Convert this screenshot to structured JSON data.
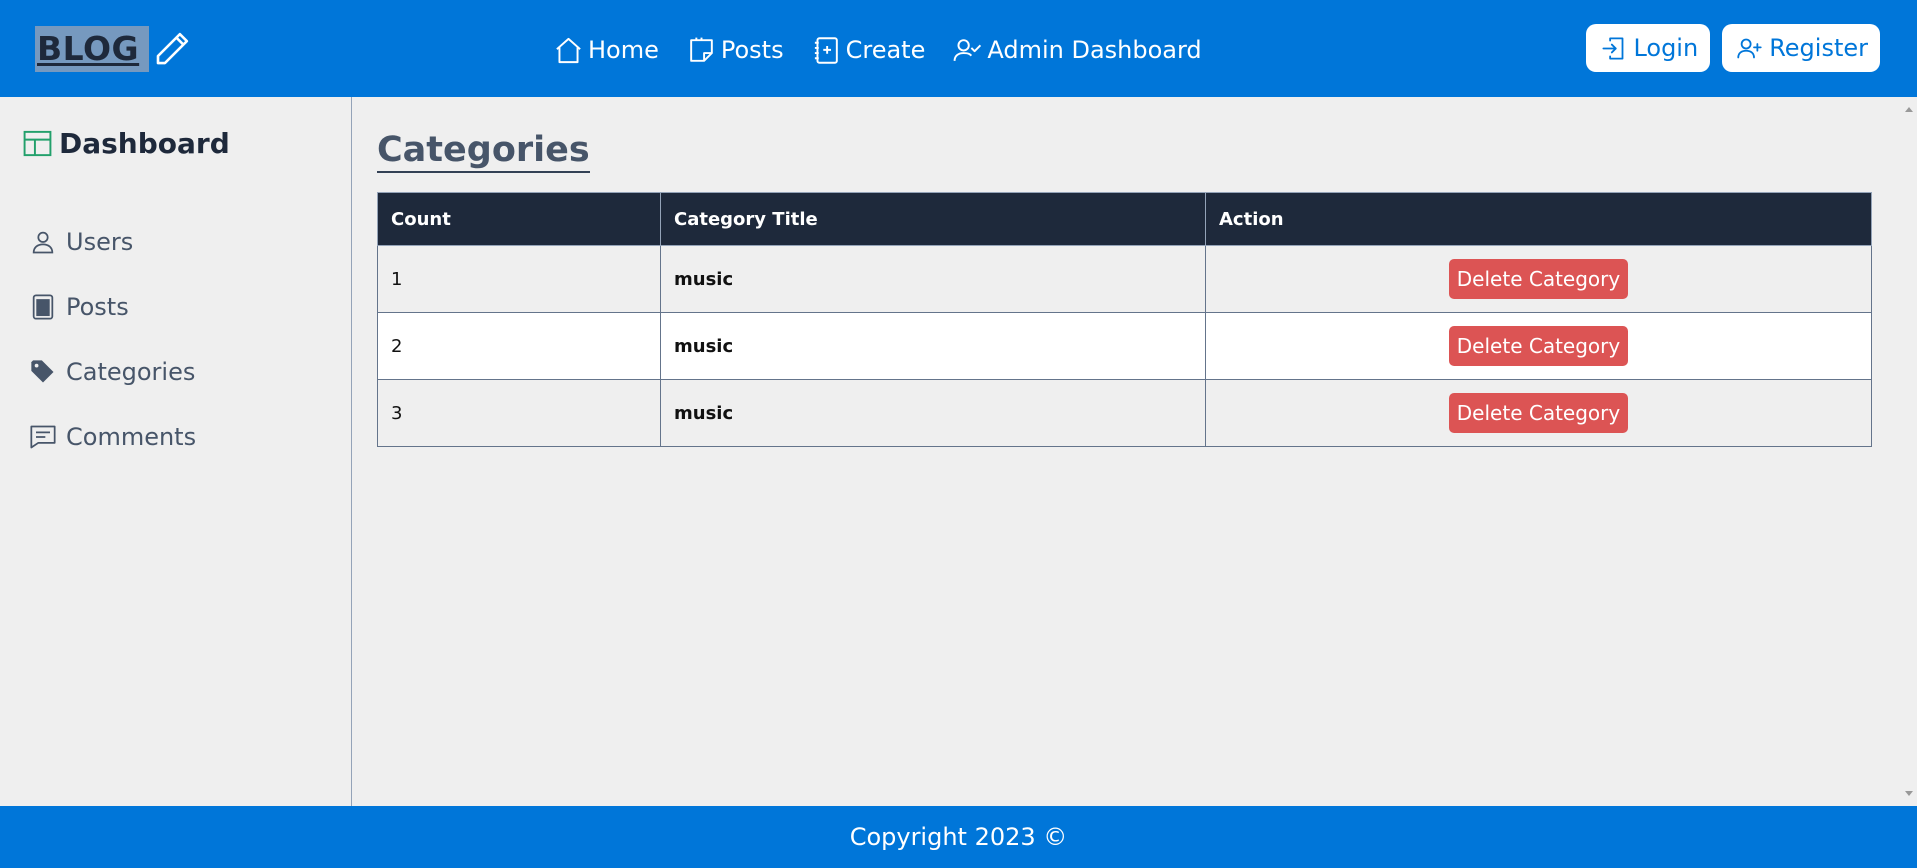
{
  "header": {
    "logo_text": "BLOG",
    "logo_icon": "pencil-icon",
    "nav": [
      {
        "label": "Home",
        "icon": "house-icon"
      },
      {
        "label": "Posts",
        "icon": "sticky-note-icon"
      },
      {
        "label": "Create",
        "icon": "journal-plus-icon"
      },
      {
        "label": "Admin Dashboard",
        "icon": "person-check-icon"
      }
    ],
    "login_label": "Login",
    "register_label": "Register"
  },
  "sidebar": {
    "title": "Dashboard",
    "items": [
      {
        "label": "Users",
        "icon": "person-icon"
      },
      {
        "label": "Posts",
        "icon": "file-icon"
      },
      {
        "label": "Categories",
        "icon": "tag-icon"
      },
      {
        "label": "Comments",
        "icon": "chat-icon"
      }
    ]
  },
  "main": {
    "title": "Categories",
    "table": {
      "headers": [
        "Count",
        "Category Title",
        "Action"
      ],
      "rows": [
        {
          "count": "1",
          "title": "music",
          "action": "Delete Category"
        },
        {
          "count": "2",
          "title": "music",
          "action": "Delete Category"
        },
        {
          "count": "3",
          "title": "music",
          "action": "Delete Category"
        }
      ]
    }
  },
  "footer": {
    "text": "Copyright 2023 ©"
  },
  "colors": {
    "primary": "#0076d9",
    "table_header": "#1e293b",
    "danger": "#dc5454",
    "dashboard_icon": "#22a06b"
  }
}
